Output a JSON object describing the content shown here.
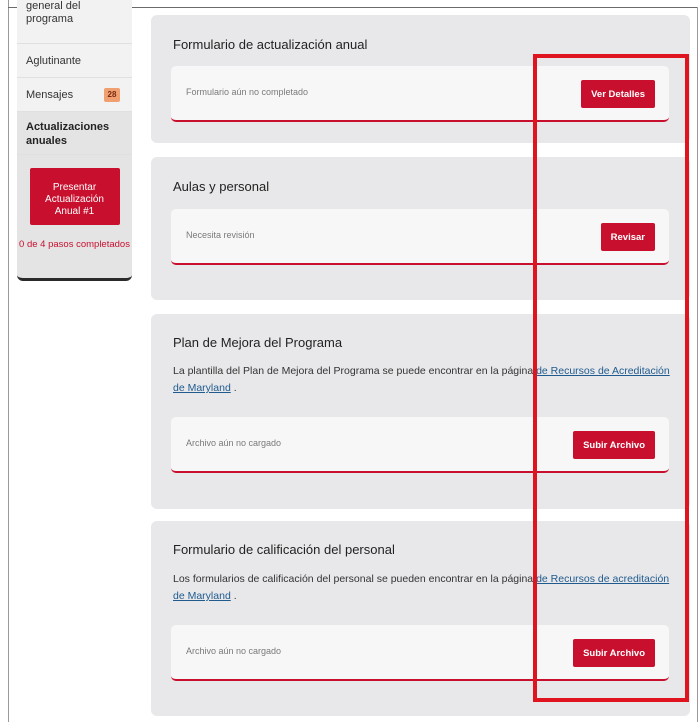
{
  "sidebar": {
    "first_item_line1": "general del",
    "first_item_line2": "programa",
    "items": [
      {
        "label": "Aglutinante"
      },
      {
        "label": "Mensajes",
        "badge": "28"
      },
      {
        "label": "Actualizaciones anuales"
      }
    ],
    "submit_button": "Presentar Actualización Anual #1",
    "steps_text": "0 de 4 pasos completados"
  },
  "cards": [
    {
      "title": "Formulario de actualización anual",
      "status": "Formulario aún no completado",
      "button": "Ver Detalles"
    },
    {
      "title": "Aulas y personal",
      "status": "Necesita revisión",
      "button": "Revisar"
    },
    {
      "title": "Plan de Mejora del Programa",
      "desc_text": "La plantilla del Plan de Mejora del Programa se puede encontrar en la página ",
      "desc_link": "de Recursos de Acreditación de Maryland",
      "desc_end": " .",
      "status": "Archivo aún no cargado",
      "button": "Subir Archivo"
    },
    {
      "title": "Formulario de calificación del personal",
      "desc_text": "Los formularios de calificación del personal se pueden encontrar en la página ",
      "desc_link": "de Recursos de acreditación de Maryland",
      "desc_end": " .",
      "status": "Archivo aún no cargado",
      "button": "Subir Archivo"
    }
  ],
  "colors": {
    "accent": "#c8102e",
    "highlight": "#e0141e",
    "card_bg": "#e8e8ea",
    "link": "#1f5b8f"
  }
}
